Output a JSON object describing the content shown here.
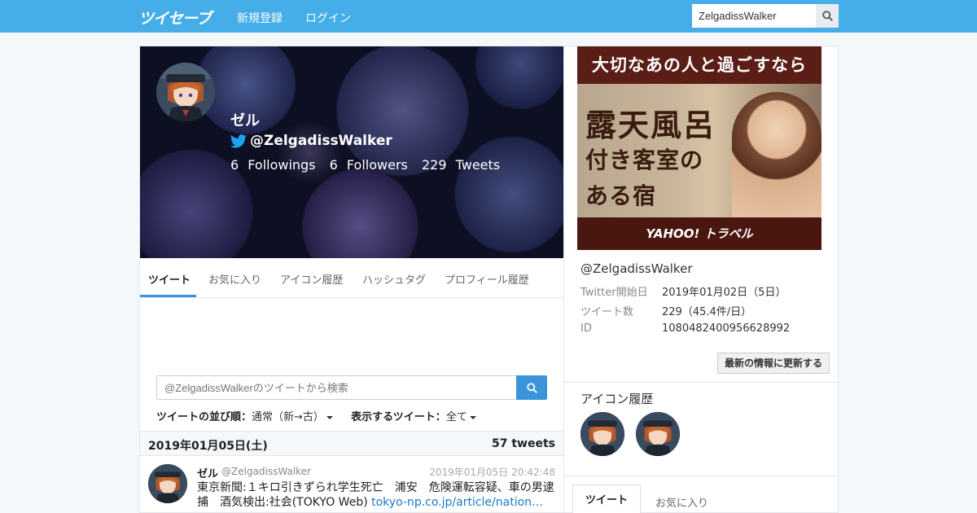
{
  "nav": {
    "logo": "ツイセーブ",
    "signup": "新規登録",
    "login": "ログイン",
    "search_value": "ZelgadissWalker"
  },
  "profile": {
    "name": "ゼル",
    "handle": "@ZelgadissWalker",
    "followings_count": "6",
    "followings_label": "Followings",
    "followers_count": "6",
    "followers_label": "Followers",
    "tweets_count": "229",
    "tweets_label": "Tweets"
  },
  "tabs": [
    {
      "label": "ツイート"
    },
    {
      "label": "お気に入り"
    },
    {
      "label": "アイコン履歴"
    },
    {
      "label": "ハッシュタグ"
    },
    {
      "label": "プロフィール履歴"
    }
  ],
  "tweet_search": {
    "placeholder": "@ZelgadissWalkerのツイートから検索"
  },
  "sort": {
    "order_label": "ツイートの並び順：",
    "order_value": "通常（新→古）",
    "filter_label": "表示するツイート：",
    "filter_value": "全て"
  },
  "timeline": {
    "date": "2019年01月05日(土)",
    "count": "57 tweets",
    "tweets": [
      {
        "name": "ゼル",
        "handle": "@ZelgadissWalker",
        "time": "2019年01月05日 20:42:48",
        "text": "東京新聞:１キロ引きずられ学生死亡　浦安　危険運転容疑、車の男逮捕　酒気検出:社会(TOKYO Web) ",
        "link": "tokyo-np.co.jp/article/nation…"
      }
    ]
  },
  "ad": {
    "top": "大切なあの人と過ごすなら",
    "line1": "露天風呂",
    "line2": "付き客室の",
    "line3": "ある宿",
    "brand": "YAHOO! トラベル"
  },
  "info": {
    "handle": "@ZelgadissWalker",
    "rows": [
      {
        "key": "Twitter開始日",
        "value": "2019年01月02日（5日）"
      },
      {
        "key": "ツイート数",
        "value": "229（45.4件/日）"
      },
      {
        "key": "ID",
        "value": "1080482400956628992"
      }
    ],
    "refresh": "最新の情報に更新する"
  },
  "icon_history": {
    "title": "アイコン履歴"
  },
  "right_tabs": [
    {
      "label": "ツイート"
    },
    {
      "label": "お気に入り"
    }
  ],
  "colors": {
    "navbar": "#45ade8",
    "accent": "#3b94d9",
    "link": "#1a7ac6",
    "twitter_bird": "#1da1f2"
  }
}
